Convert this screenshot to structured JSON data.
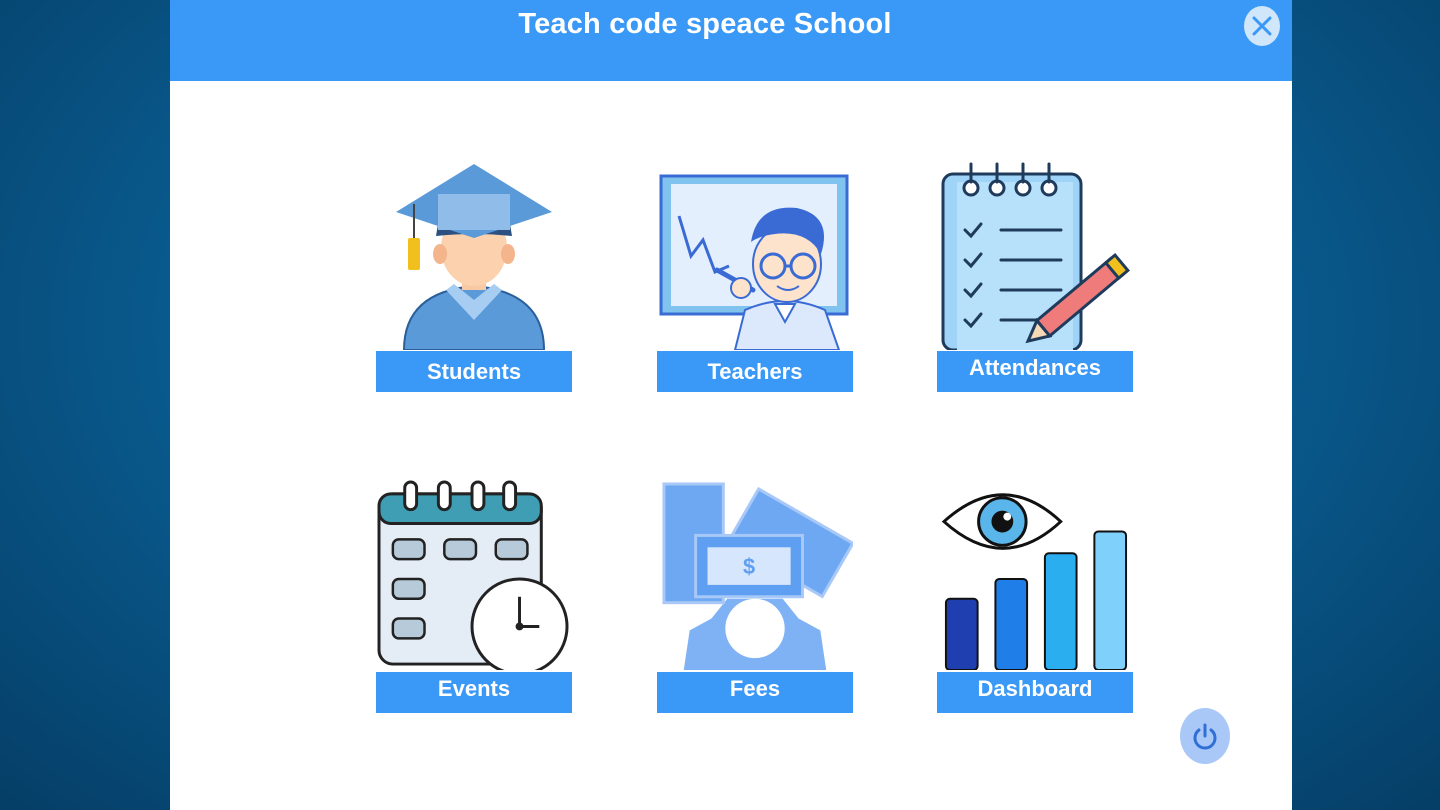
{
  "app": {
    "title": "Teach code speace School"
  },
  "controls": {
    "close_icon": "close-icon",
    "power_icon": "power-icon"
  },
  "menu": {
    "items": [
      {
        "label": "Students",
        "icon": "graduate-student-icon"
      },
      {
        "label": "Teachers",
        "icon": "teacher-whiteboard-icon"
      },
      {
        "label": "Attendances",
        "icon": "checklist-notepad-icon"
      },
      {
        "label": "Events",
        "icon": "calendar-clock-icon"
      },
      {
        "label": "Fees",
        "icon": "money-gear-icon"
      },
      {
        "label": "Dashboard",
        "icon": "eye-bar-chart-icon"
      }
    ]
  },
  "colors": {
    "header": "#3a99f6",
    "tile_label": "#3a99f6",
    "background": "#0a5f95",
    "power_button": "#a9c8f7"
  }
}
